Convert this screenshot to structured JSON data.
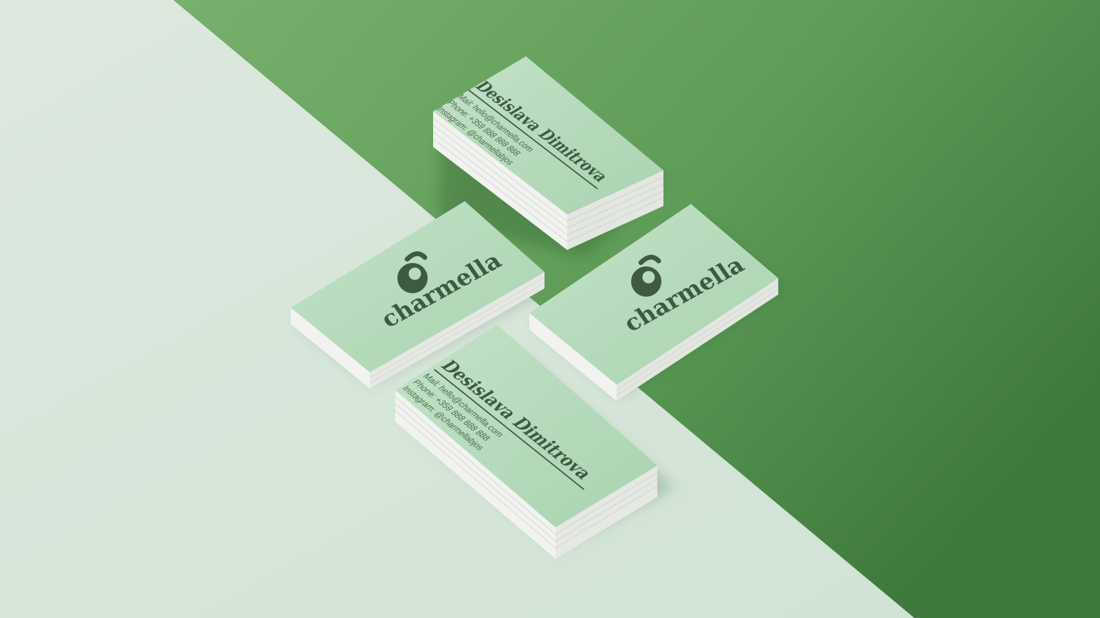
{
  "colors": {
    "light_surface": "#dfe9e1",
    "green_surface": "#5c9c57",
    "card_face": "#b7dcbd",
    "card_edge": "#f4f4f2",
    "ink": "#3f5a40"
  },
  "front_card_top": {
    "name": "Desislava Dimitrova",
    "mail": "Mail: hello@charmella.com",
    "phone": "Phone: +359 888 888 888",
    "instagram": "Instagram: @charmellabjos"
  },
  "front_card_bottom": {
    "name": "Desislava Dimitrova",
    "mail": "Mail: hello@charmella.com",
    "phone": "Phone: +359 888 888 888",
    "instagram": "Instagram: @charmellabjos"
  },
  "logo_card_left": {
    "wordmark": "charmella"
  },
  "logo_card_right": {
    "wordmark": "charmella"
  }
}
